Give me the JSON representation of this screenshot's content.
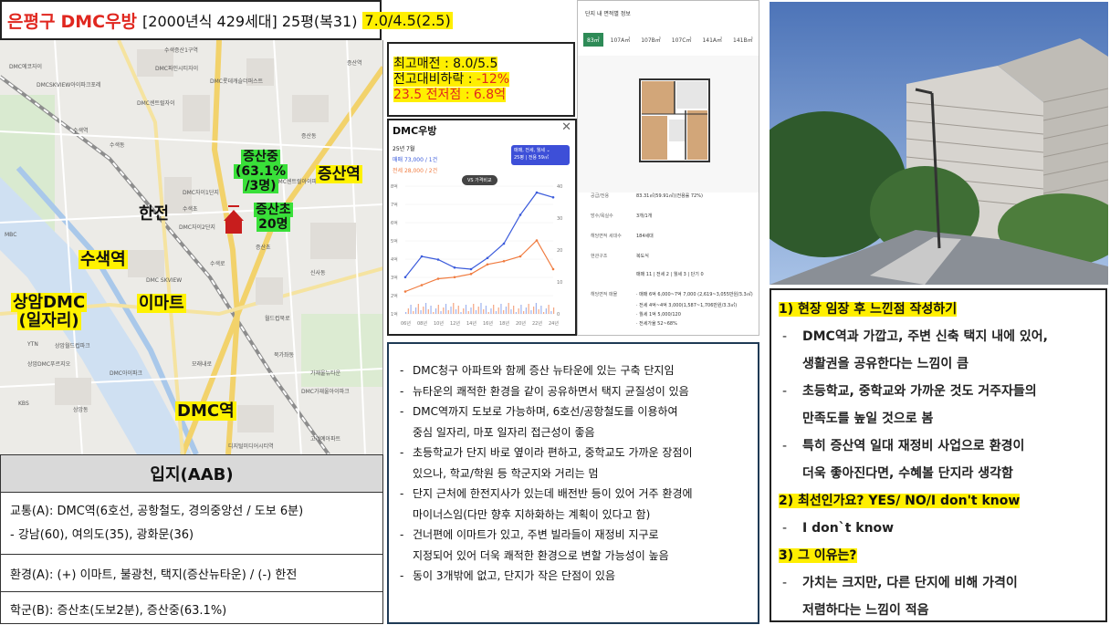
{
  "title": {
    "district": "은평구",
    "apt": "DMC우방",
    "info": "[2000년식 429세대]  25평(복31)",
    "price": "7.0/4.5(2.5)"
  },
  "map": {
    "labels": {
      "hanjeon": "한전",
      "susaek": "수색역",
      "emart": "이마트",
      "sangam_line1": "상암DMC",
      "sangam_line2": "(일자리)",
      "dmc_station": "DMC역",
      "jeungsan_station": "증산역",
      "jeungsan_middle_1": "증산중",
      "jeungsan_middle_2": "(63.1%",
      "jeungsan_middle_3": "/3명)",
      "jeungsan_elem_1": "증산초",
      "jeungsan_elem_2": "20명"
    },
    "small": [
      "DMC에코자이",
      "DMCSKVIEW아이파크포레",
      "수색증산1구역",
      "DMC파인시티자이",
      "수색역",
      "수색동",
      "DMC센트럴자이",
      "DMC롯데캐슬더퍼스트",
      "DMC SKVIEW",
      "수색초",
      "DMC자이1단지",
      "DMC자이2단지",
      "증산초",
      "DMC센트럴아이파크",
      "증산역",
      "신사동",
      "증산동",
      "수색로",
      "월드컵북로",
      "상암동",
      "상암월드컵파크",
      "MBC",
      "YTN",
      "KBS",
      "상암DMC푸르지오",
      "DMC아이파크",
      "디지털미디어시티역",
      "가재울뉴타운",
      "DMC가재울아이파크",
      "고려예아파트",
      "북가좌동",
      "모래내로"
    ]
  },
  "location": {
    "header": "입지(AAB)",
    "transport_line1": "교통(A): DMC역(6호선, 공항철도, 경의중앙선 / 도보 6분)",
    "transport_line2": "-  강남(60), 여의도(35), 광화문(36)",
    "environment": "환경(A): (+) 이마트, 불광천, 택지(증산뉴타운) / (-) 한전",
    "school": "학군(B): 증산초(도보2분), 증산중(63.1%)"
  },
  "price_box": {
    "line1": "최고매전 : 8.0/5.5",
    "line2_prefix": "전고대비하락 : ",
    "line2_value": "-12%",
    "line3": "23.5 전저점 : 6.8억"
  },
  "chart_panel": {
    "title": "DMC우방",
    "close": "✕",
    "date": "25년 7월",
    "sale": "매매 73,000 / 1건",
    "jeonse": "전세 28,000 / 2건",
    "badge_line1": "매매, 전세, 월세 ⌄",
    "badge_line2": "25평 | 전용 59㎡",
    "vs_button": "VS 가격비교"
  },
  "chart_data": {
    "type": "line",
    "x": [
      "06년",
      "08년",
      "10년",
      "12년",
      "14년",
      "16년",
      "18년",
      "20년",
      "22년",
      "24년"
    ],
    "y_left_ticks": [
      "8억",
      "7억",
      "6억",
      "5억",
      "4억",
      "3억",
      "2억",
      "1억"
    ],
    "y_right_ticks": [
      "40",
      "30",
      "20",
      "10",
      "0"
    ],
    "series": [
      {
        "name": "매매",
        "color": "#3b5bdb",
        "values": [
          2.3,
          3.6,
          3.4,
          2.9,
          2.8,
          3.5,
          4.4,
          6.2,
          7.6,
          7.3
        ]
      },
      {
        "name": "전세",
        "color": "#f07b3f",
        "values": [
          1.4,
          1.8,
          2.2,
          2.3,
          2.5,
          3.1,
          3.3,
          3.6,
          4.6,
          2.8
        ]
      }
    ]
  },
  "plan_panel": {
    "title": "단지 내 면적별 정보",
    "tabs": [
      "83㎡",
      "107A㎡",
      "107B㎡",
      "107C㎡",
      "141A㎡",
      "141B㎡"
    ],
    "rows": [
      {
        "label": "공급/전용",
        "value": "83.31㎡(59.91㎡)(전용률 72%)"
      },
      {
        "label": "방수/욕실수",
        "value": "3개/1개"
      },
      {
        "label": "해당면적 세대수",
        "value": "184세대"
      },
      {
        "label": "현관구조",
        "value": "복도식"
      },
      {
        "label": "",
        "value": "매매 11 | 전세 2 | 월세 3 | 단기 0"
      },
      {
        "label": "해당면적 매물",
        "value": "· 매매 6억 6,000~7억 7,000 (2,619~3,055만원/3.3㎡)"
      },
      {
        "label": "",
        "value": "· 전세 4억~4억 3,000(1,587~1,706만원/3.3㎡)"
      },
      {
        "label": "",
        "value": "· 월세 1억 5,000/120"
      },
      {
        "label": "",
        "value": "· 전세가율 52~68%"
      }
    ]
  },
  "description": [
    "DMC청구 아파트와 함께 증산 뉴타운에 있는 구축 단지임",
    "뉴타운의 쾌적한 환경을 같이 공유하면서 택지 균질성이 있음",
    "DMC역까지 도보로 가능하며, 6호선/공항철도를 이용하여",
    "중심 일자리, 마포 일자리 접근성이 좋음",
    "초등학교가 단지 바로 옆이라 편하고, 중학교도 가까운 장점이",
    "있으나, 학교/학원 등 학군지와 거리는 멈",
    "단지 근처에 한전지사가 있는데 배전반 등이 있어 거주 환경에",
    "마이너스임(다만 향후 지하화하는 계획이 있다고 함)",
    "건너편에 이마트가 있고, 주변 빌라들이 재정비 지구로",
    "지정되어 있어 더욱 쾌적한 환경으로 변할 가능성이 높음",
    "동이 3개밖에 없고, 단지가 작은 단점이 있음"
  ],
  "impressions": {
    "q1": "1) 현장 임장 후 느낀점 작성하기",
    "q1_items": [
      "DMC역과 가깝고, 주변 신축 택지 내에 있어,",
      "생활권을 공유한다는 느낌이 큼",
      "초등학교, 중학교와 가까운 것도 거주자들의",
      "만족도를 높일 것으로 봄",
      "특히 증산역 일대 재정비 사업으로 환경이",
      "더욱 좋아진다면, 수혜볼 단지라 생각함"
    ],
    "q2": "2) 최선인가요? YES/  NO/I don't know",
    "q2_item": "I don`t know",
    "q3": "3) 그 이유는?",
    "q3_items": [
      "가치는 크지만, 다른 단지에 비해 가격이",
      "저렴하다는 느낌이 적음"
    ]
  }
}
